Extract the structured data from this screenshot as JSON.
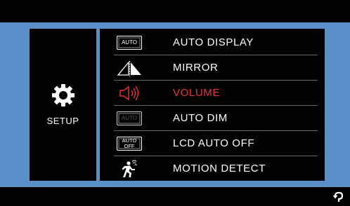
{
  "sidebar": {
    "icon": "gear-icon",
    "label": "SETUP"
  },
  "menu": {
    "active_index": 2,
    "active_color": "#e8333c",
    "items": [
      {
        "label": "AUTO DISPLAY",
        "icon": "auto-display-icon",
        "icon_text": "AUTO"
      },
      {
        "label": "MIRROR",
        "icon": "mirror-icon"
      },
      {
        "label": "VOLUME",
        "icon": "speaker-icon"
      },
      {
        "label": "AUTO DIM",
        "icon": "auto-dim-icon",
        "icon_text": "AUTO"
      },
      {
        "label": "LCD AUTO OFF",
        "icon": "lcd-auto-off-icon",
        "icon_text_line1": "AUTO",
        "icon_text_line2": "OFF"
      },
      {
        "label": "MOTION DETECT",
        "icon": "motion-detect-icon"
      }
    ]
  },
  "footer": {
    "back_icon": "back-arrow-icon"
  },
  "colors": {
    "frame": "#5b8fc9",
    "background": "#000000",
    "text": "#ffffff"
  }
}
